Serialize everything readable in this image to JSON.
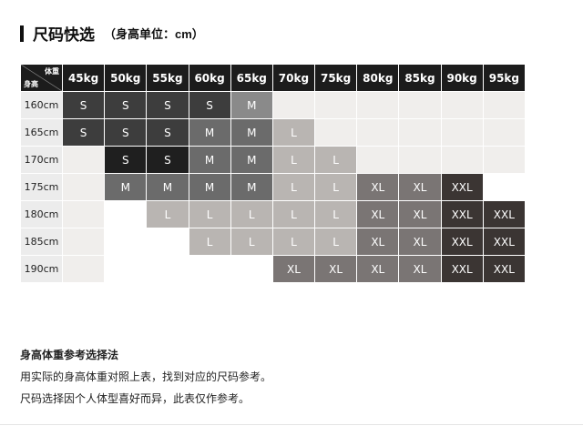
{
  "header": {
    "title": "尺码快选",
    "subtitle": "（身高单位：cm）"
  },
  "table": {
    "corner_weight": "体重",
    "corner_height": "身高",
    "weights": [
      "45kg",
      "50kg",
      "55kg",
      "60kg",
      "65kg",
      "70kg",
      "75kg",
      "80kg",
      "85kg",
      "90kg",
      "95kg"
    ],
    "rows": [
      {
        "height": "160cm",
        "cells": [
          "S",
          "S",
          "S",
          "S",
          "M",
          "",
          "",
          "",
          "",
          "",
          ""
        ]
      },
      {
        "height": "165cm",
        "cells": [
          "S",
          "S",
          "S",
          "M",
          "M",
          "L",
          "",
          "",
          "",
          "",
          ""
        ]
      },
      {
        "height": "170cm",
        "cells": [
          "",
          "S",
          "S",
          "M",
          "M",
          "L",
          "L",
          "",
          "",
          "",
          ""
        ]
      },
      {
        "height": "175cm",
        "cells": [
          "",
          "M",
          "M",
          "M",
          "M",
          "L",
          "L",
          "XL",
          "XL",
          "XXL",
          ""
        ]
      },
      {
        "height": "180cm",
        "cells": [
          "",
          "",
          "L",
          "L",
          "L",
          "L",
          "L",
          "XL",
          "XL",
          "XXL",
          "XXL"
        ]
      },
      {
        "height": "185cm",
        "cells": [
          "",
          "",
          "",
          "L",
          "L",
          "L",
          "L",
          "XL",
          "XL",
          "XXL",
          "XXL"
        ]
      },
      {
        "height": "190cm",
        "cells": [
          "",
          "",
          "",
          "",
          "",
          "XL",
          "XL",
          "XL",
          "XL",
          "XXL",
          "XXL"
        ]
      }
    ],
    "colors": {
      "header_bg": "#1c1c1c",
      "S": "#3d3d3d",
      "M": "#6b6b6b",
      "L": "#b9b5b2",
      "XL": "#7a7574",
      "XXL": "#3b3533"
    }
  },
  "notes": {
    "heading": "身高体重参考选择法",
    "line1": "用实际的身高体重对照上表，找到对应的尺码参考。",
    "line2": "尺码选择因个人体型喜好而异，此表仅作参考。"
  }
}
